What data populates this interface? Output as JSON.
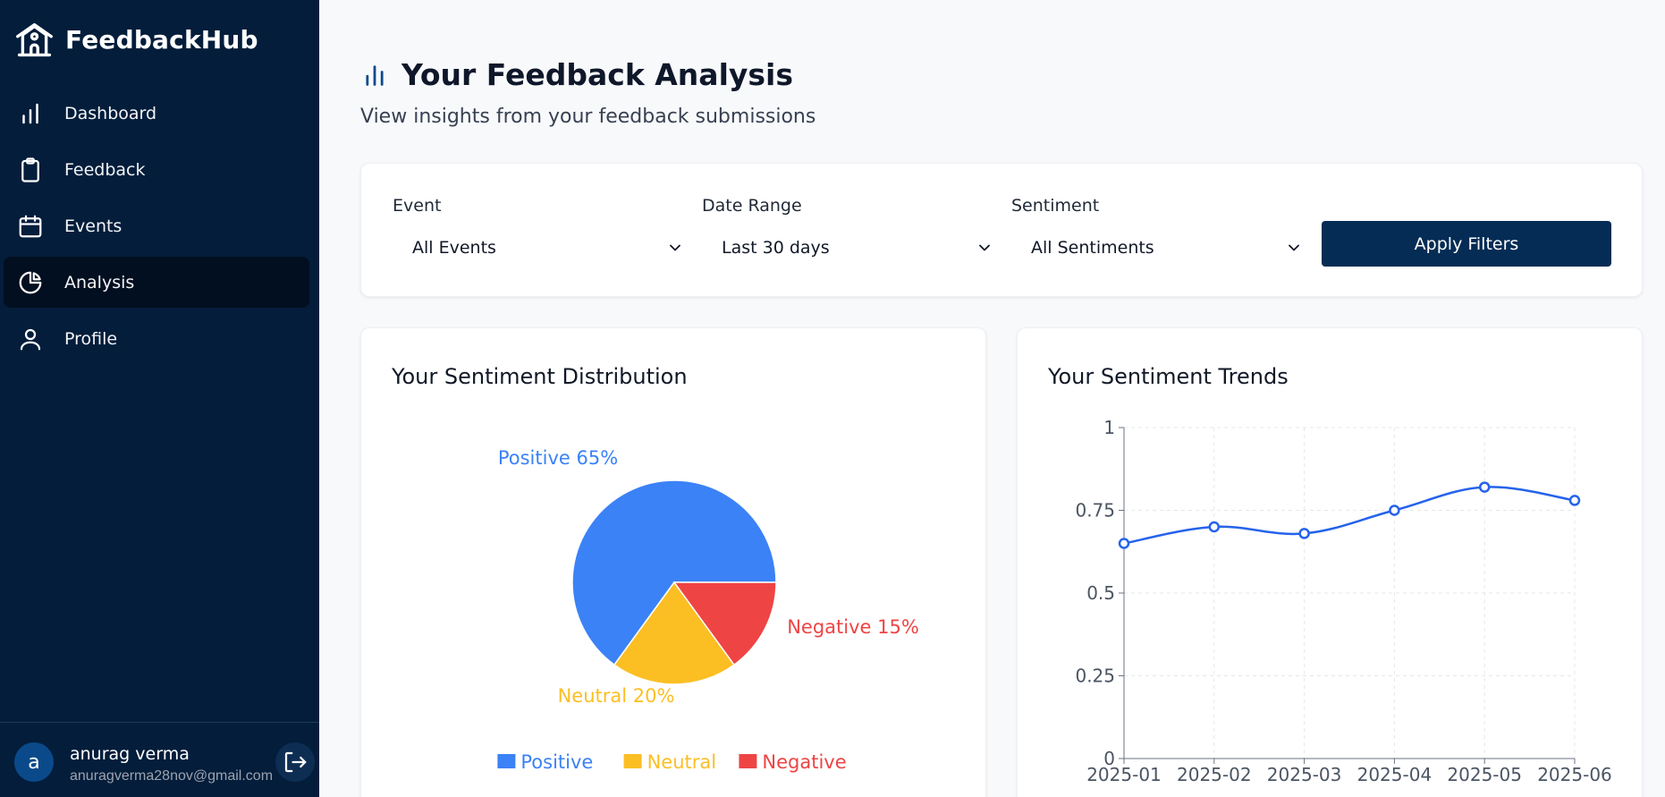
{
  "app": {
    "name": "FeedbackHub"
  },
  "sidebar": {
    "items": [
      {
        "label": "Dashboard",
        "icon": "bar-chart-icon"
      },
      {
        "label": "Feedback",
        "icon": "clipboard-icon"
      },
      {
        "label": "Events",
        "icon": "calendar-icon"
      },
      {
        "label": "Analysis",
        "icon": "pie-chart-icon",
        "active": true
      },
      {
        "label": "Profile",
        "icon": "user-icon"
      }
    ],
    "user": {
      "initial": "a",
      "name": "anurag verma",
      "email": "anuragverma28nov@gmail.com"
    }
  },
  "header": {
    "title": "Your Feedback Analysis",
    "subtitle": "View insights from your feedback submissions"
  },
  "filters": {
    "event": {
      "label": "Event",
      "value": "All Events"
    },
    "date_range": {
      "label": "Date Range",
      "value": "Last 30 days"
    },
    "sentiment": {
      "label": "Sentiment",
      "value": "All Sentiments"
    },
    "apply_label": "Apply Filters"
  },
  "colors": {
    "positive": "#3b82f6",
    "neutral": "#fbbf24",
    "negative": "#ef4444",
    "line": "#2563eb",
    "sidebar": "#031d3b",
    "primary_button": "#052c54"
  },
  "chart_data": [
    {
      "type": "pie",
      "title": "Your Sentiment Distribution",
      "categories": [
        "Positive",
        "Neutral",
        "Negative"
      ],
      "values": [
        65,
        20,
        15
      ],
      "data_labels": [
        "Positive 65%",
        "Neutral 20%",
        "Negative 15%"
      ],
      "legend": "bottom"
    },
    {
      "type": "line",
      "title": "Your Sentiment Trends",
      "x": [
        "2025-01",
        "2025-02",
        "2025-03",
        "2025-04",
        "2025-05",
        "2025-06"
      ],
      "series": [
        {
          "values": [
            0.65,
            0.7,
            0.68,
            0.75,
            0.82,
            0.78
          ]
        }
      ],
      "ylim": [
        0,
        1
      ],
      "yticks": [
        "0",
        "0.25",
        "0.5",
        "0.75",
        "1"
      ],
      "grid": true
    }
  ]
}
